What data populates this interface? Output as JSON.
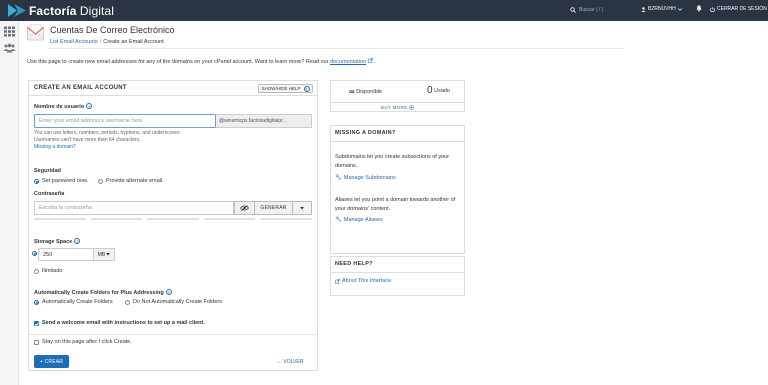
{
  "topbar": {
    "brand_bold": "Factoría",
    "brand_light": " Digital",
    "search_placeholder": "Buscar ( / )",
    "username": "BZRNUVHH",
    "logout": "CERRAR DE SESIÓN"
  },
  "header": {
    "title": "Cuentas De Correo Electrónico",
    "breadcrumb_parent": "List Email Accounts",
    "breadcrumb_sep": "/",
    "breadcrumb_current": "Create an Email Account"
  },
  "intro": {
    "text": "Use this page to create new email addresses for any of the domains on your cPanel account. Want to learn more? Read our",
    "link": "documentation",
    "after": "."
  },
  "form": {
    "panel_title": "CREATE AN EMAIL ACCOUNT",
    "help_button": "SHOW/HIDE HELP",
    "username_label": "Nombre de usuario",
    "username_placeholder": "Enter your email address's username here.",
    "domain": "@winamicps.factoriadigitalpr...",
    "hint1": "You can use letters, numbers, periods, hyphens, and underscores.",
    "hint2": "Usernames can't have more than 64 characters.",
    "missing_domain": "Missing a domain?",
    "security_label": "Seguridad",
    "set_password_now": "Set password now.",
    "provide_alternate": "Provide alternate email.",
    "password_label": "Contraseña",
    "password_placeholder": "Escriba la contraseña",
    "generate": "GENERAR",
    "storage_label": "Storage Space",
    "storage_value": "250",
    "storage_unit": "MB",
    "unlimited": "Ilimitado",
    "plus_label": "Automatically Create Folders for Plus Addressing",
    "auto_folders": "Automatically Create Folders",
    "no_auto_folders": "Do Not Automatically Create Folders",
    "welcome_email": "Send a welcome email with instructions to set up a mail client.",
    "stay_on_page": "Stay on this page after I click Create.",
    "create": "CREAR",
    "back": "VOLVER"
  },
  "stats": {
    "available_symbol": "∞",
    "available_label": "Disponible",
    "used_value": "0",
    "used_label": "Usado",
    "buy_more": "BUY MORE"
  },
  "missing_domain_box": {
    "title": "MISSING A DOMAIN?",
    "text1": "Subdomains let you create subsections of your domains.",
    "link1": "Manage Subdomains",
    "text2": "Aliases let you point a domain towards another of your domains' content.",
    "link2": "Manage Aliases"
  },
  "help_box": {
    "title": "NEED HELP?",
    "link": "About This Interface"
  },
  "colors": {
    "topbar": "#2a3442",
    "accent": "#1f6db5",
    "logo": "#3ab0d6"
  }
}
